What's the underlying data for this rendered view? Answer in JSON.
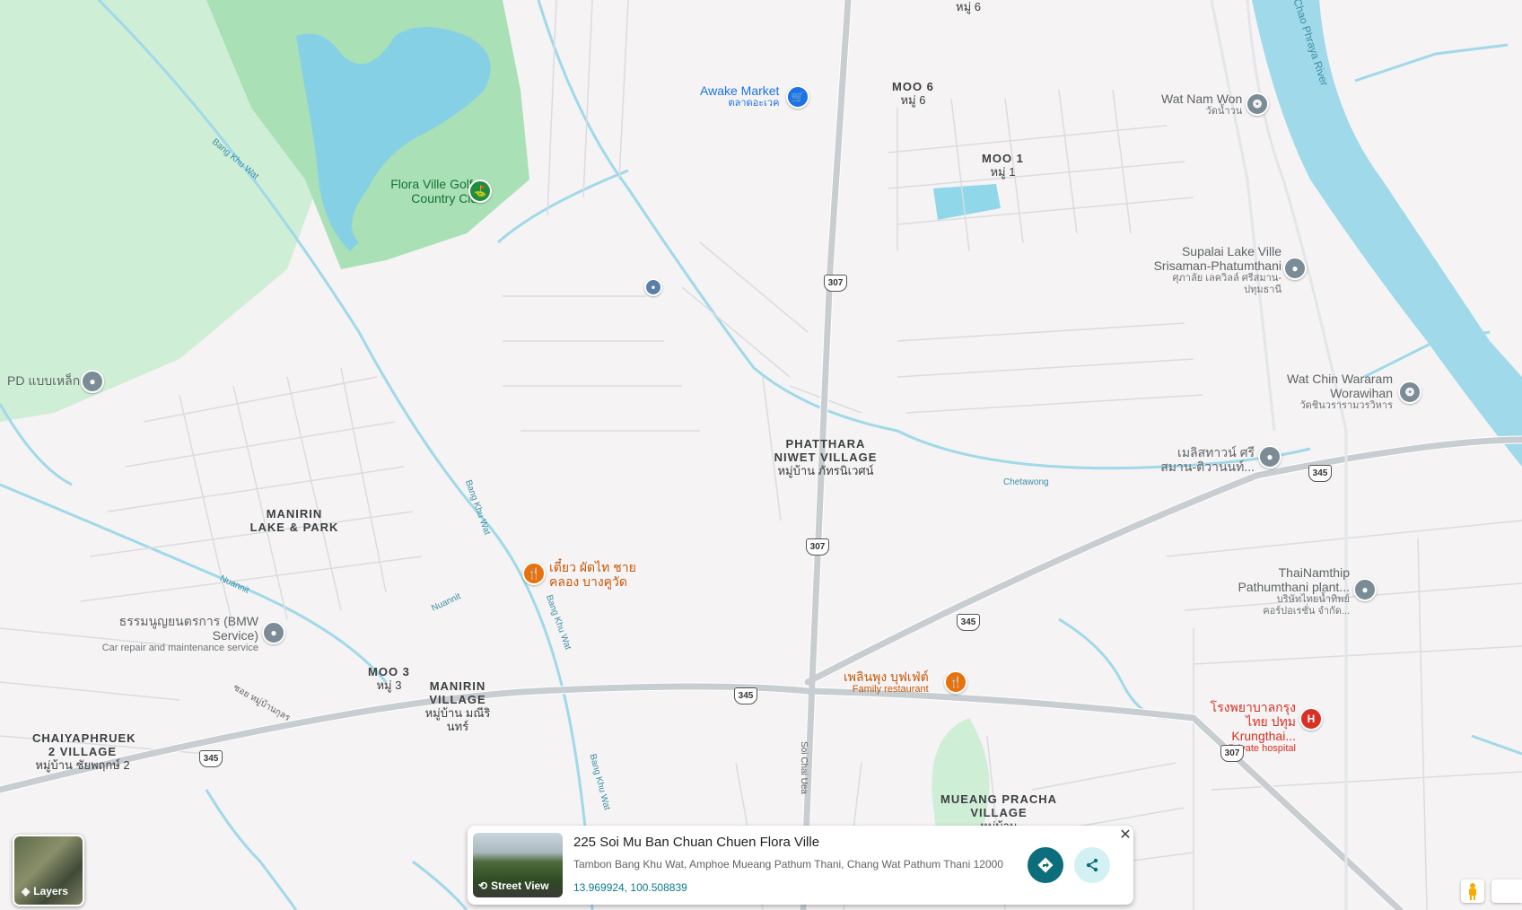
{
  "map": {
    "areas": [
      {
        "id": "moo6-top",
        "en": "",
        "th": "หมู่ 6"
      },
      {
        "id": "moo6",
        "en": "MOO 6",
        "th": "หมู่ 6"
      },
      {
        "id": "moo1",
        "en": "MOO 1",
        "th": "หมู่ 1"
      },
      {
        "id": "phatthara",
        "en": "PHATTHARA NIWET VILLAGE",
        "th": "หมู่บ้าน ภัทรนิเวศน์"
      },
      {
        "id": "manirin-lake",
        "en": "MANIRIN LAKE & PARK",
        "th": ""
      },
      {
        "id": "moo3",
        "en": "MOO 3",
        "th": "หมู่ 3"
      },
      {
        "id": "manirin-village",
        "en": "MANIRIN VILLAGE",
        "th": "หมู่บ้าน มณีรินทร์"
      },
      {
        "id": "chaiyaphruek",
        "en": "CHAIYAPHRUEK 2 VILLAGE",
        "th": "หมู่บ้าน ชัยพฤกษ์ 2"
      },
      {
        "id": "mueang-pracha",
        "en": "MUEANG PRACHA VILLAGE",
        "th": "หมู่บ้าน"
      }
    ],
    "pois": [
      {
        "id": "awake-market",
        "name": "Awake Market",
        "sub": "ตลาดอะเวค",
        "color": "#1a73e8",
        "icon": "cart-icon"
      },
      {
        "id": "flora-ville-golf",
        "name": "Flora Ville Golf & Country Club",
        "sub": "",
        "color": "#1e8e3e",
        "icon": "golf-icon"
      },
      {
        "id": "wat-nam-won",
        "name": "Wat Nam Won",
        "sub": "วัดน้ำวน",
        "color": "#7b8c96",
        "icon": "temple-icon"
      },
      {
        "id": "supalai",
        "name": "Supalai Lake Ville Srisaman-Phatumthani",
        "sub": "ศุภาลัย เลควิลล์ ศรีสมาน-ปทุมธานี",
        "color": "#7b8c96",
        "icon": "pin-icon"
      },
      {
        "id": "wat-chin",
        "name": "Wat Chin Wararam Worawihan",
        "sub": "วัดชินวรารามวรวิหาร",
        "color": "#7b8c96",
        "icon": "temple-icon"
      },
      {
        "id": "pd",
        "name": "PD แบบเหล็ก",
        "sub": "",
        "color": "#7b8c96",
        "icon": "pin-icon"
      },
      {
        "id": "meliscity",
        "name": "เมลิสทาวน์ ศรีสมาน-ติวานนท์...",
        "sub": "",
        "color": "#7b8c96",
        "icon": "pin-icon"
      },
      {
        "id": "thainamthip",
        "name": "ThaiNamthip Pathumthani plant...",
        "sub": "บริษัทไทยน้ำทิพย์ คอร์ปอเรชั่น จำกัด...",
        "color": "#7b8c96",
        "icon": "pin-icon"
      },
      {
        "id": "tiew",
        "name": "เตี๋ยว ผัดไท ชายคลอง บางคูวัด",
        "sub": "",
        "color": "#e8710a",
        "icon": "restaurant-icon"
      },
      {
        "id": "bmw",
        "name": "ธรรมนูญยนตรการ (BMW Service)",
        "sub": "Car repair and maintenance service",
        "color": "#7b8c96",
        "icon": "pin-icon"
      },
      {
        "id": "phloen",
        "name": "เพลินพุง บุฟเฟ่ต์",
        "sub": "Family restaurant",
        "color": "#e8710a",
        "icon": "restaurant-icon"
      },
      {
        "id": "krungthai",
        "name": "โรงพยาบาลกรุงไทย ปทุม Krungthai...",
        "sub": "Private hospital",
        "color": "#d93025",
        "icon": "hospital-icon"
      }
    ],
    "roads": {
      "shields": [
        "307",
        "307",
        "345",
        "345",
        "345",
        "345",
        "307"
      ],
      "streets": [
        "Bang Khu Wat",
        "Bang Khu Wat",
        "Bang Khu Wat",
        "Bang Khu Wat",
        "Soi Chai Uea",
        "Chetawong",
        "Nuannit",
        "Nuannit",
        "ซอย หมู่บ้านกุลร"
      ],
      "river": "Chao Phraya River"
    }
  },
  "controls": {
    "layers_label": "Layers"
  },
  "place_card": {
    "title": "225 Soi Mu Ban Chuan Chuen Flora Ville",
    "address": "Tambon Bang Khu Wat, Amphoe Mueang Pathum Thani, Chang Wat Pathum Thani 12000",
    "coordinates": "13.969924, 100.508839",
    "street_view_label": "Street View",
    "close_label": "✕"
  }
}
